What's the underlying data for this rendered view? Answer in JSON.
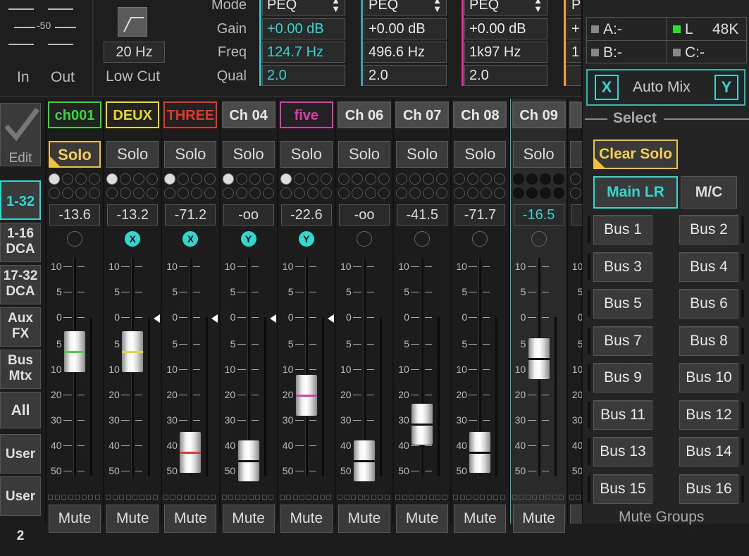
{
  "meter": {
    "scale_label": "-50",
    "in_label": "In",
    "out_label": "Out"
  },
  "low_cut": {
    "freq": "20 Hz",
    "label": "Low Cut"
  },
  "peq": {
    "row_labels": [
      "Mode",
      "Gain",
      "Freq",
      "Qual"
    ],
    "bands": [
      {
        "mode": "PEQ",
        "gain": "+0.00 dB",
        "freq": "124.7 Hz",
        "qual": "2.0",
        "color": "#33c7c7"
      },
      {
        "mode": "PEQ",
        "gain": "+0.00 dB",
        "freq": "496.6 Hz",
        "qual": "2.0",
        "color": "#3aa0c0"
      },
      {
        "mode": "PEQ",
        "gain": "+0.00 dB",
        "freq": "1k97 Hz",
        "qual": "2.0",
        "color": "#e0389a"
      },
      {
        "mode": "P",
        "gain": "+",
        "freq": "1",
        "qual": "",
        "color": "#f0a030"
      }
    ]
  },
  "status": {
    "a": "A:-",
    "l": "L",
    "rate": "48K",
    "b": "B:-",
    "c": "C:-"
  },
  "automix": {
    "x": "X",
    "label": "Auto Mix",
    "y": "Y"
  },
  "select_label": "Select",
  "clear_solo": "Clear Solo",
  "main_lr": "Main LR",
  "mc": "M/C",
  "buses": [
    "Bus 1",
    "Bus 2",
    "Bus 3",
    "Bus 4",
    "Bus 5",
    "Bus 6",
    "Bus 7",
    "Bus 8",
    "Bus 9",
    "Bus 10",
    "Bus 11",
    "Bus 12",
    "Bus 13",
    "Bus 14",
    "Bus 15",
    "Bus 16"
  ],
  "mute_groups": "Mute Groups",
  "nav": {
    "edit": "Edit",
    "items": [
      "1-32",
      "1-16 DCA",
      "17-32 DCA",
      "Aux FX",
      "Bus Mtx",
      "All",
      "User 1",
      "User 2"
    ]
  },
  "scale_ticks": [
    "10",
    "5",
    "0",
    "5",
    "10",
    "20",
    "30",
    "40",
    "50"
  ],
  "channels": [
    {
      "name": "ch001",
      "color": "#3bd63b",
      "solo": "Solo",
      "solo_active": true,
      "gain": "-13.6",
      "assign": "",
      "fader_pos": 0.43,
      "line": "#3bd63b",
      "has_marker": false,
      "mute": "Mute"
    },
    {
      "name": "DEUX",
      "color": "#e8d82a",
      "solo": "Solo",
      "solo_active": false,
      "gain": "-13.2",
      "assign": "X",
      "fader_pos": 0.43,
      "line": "#e8d82a",
      "has_marker": true,
      "mute": "Mute"
    },
    {
      "name": "THREE",
      "color": "#e03a2a",
      "solo": "Solo",
      "solo_active": false,
      "gain": "-71.2",
      "assign": "X",
      "fader_pos": 0.89,
      "line": "#e03a2a",
      "has_marker": true,
      "mute": "Mute"
    },
    {
      "name": "Ch 04",
      "color": "",
      "solo": "Solo",
      "solo_active": false,
      "gain": "-oo",
      "assign": "Y",
      "fader_pos": 0.93,
      "line": "#111111",
      "has_marker": true,
      "mute": "Mute"
    },
    {
      "name": "five",
      "color": "#e03ab0",
      "solo": "Solo",
      "solo_active": false,
      "gain": "-22.6",
      "assign": "Y",
      "fader_pos": 0.63,
      "line": "#e03ab0",
      "has_marker": true,
      "mute": "Mute"
    },
    {
      "name": "Ch 06",
      "color": "",
      "solo": "Solo",
      "solo_active": false,
      "gain": "-oo",
      "assign": "",
      "fader_pos": 0.93,
      "line": "#111111",
      "has_marker": false,
      "mute": "Mute"
    },
    {
      "name": "Ch 07",
      "color": "",
      "solo": "Solo",
      "solo_active": false,
      "gain": "-41.5",
      "assign": "",
      "fader_pos": 0.76,
      "line": "#111111",
      "has_marker": false,
      "mute": "Mute"
    },
    {
      "name": "Ch 08",
      "color": "",
      "solo": "Solo",
      "solo_active": false,
      "gain": "-71.7",
      "assign": "",
      "fader_pos": 0.89,
      "line": "#111111",
      "has_marker": false,
      "mute": "Mute"
    },
    {
      "name": "Ch 09",
      "color": "",
      "solo": "Solo",
      "solo_active": false,
      "gain": "-16.5",
      "assign": "",
      "fader_pos": 0.46,
      "line": "#111111",
      "has_marker": false,
      "mute": "Mute",
      "selected": true
    },
    {
      "name": "Ch",
      "color": "",
      "solo": "",
      "solo_active": false,
      "gain": "",
      "assign": "",
      "fader_pos": 0.46,
      "line": "#111111",
      "has_marker": false,
      "mute": ""
    }
  ]
}
